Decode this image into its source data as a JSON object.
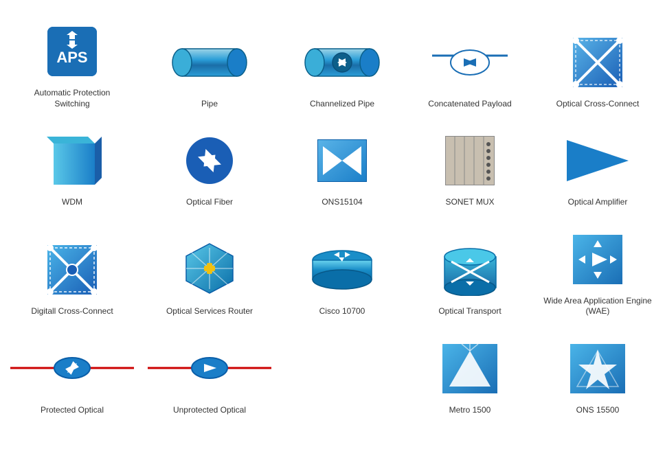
{
  "items": [
    {
      "id": "aps",
      "label": "Automatic Protection\nSwitching",
      "row": 1
    },
    {
      "id": "pipe",
      "label": "Pipe",
      "row": 1
    },
    {
      "id": "channelized-pipe",
      "label": "Channelized Pipe",
      "row": 1
    },
    {
      "id": "concatenated-payload",
      "label": "Concatenated Payload",
      "row": 1
    },
    {
      "id": "optical-cross-connect",
      "label": "Optical Cross-Connect",
      "row": 1
    },
    {
      "id": "wdm",
      "label": "WDM",
      "row": 2
    },
    {
      "id": "optical-fiber",
      "label": "Optical Fiber",
      "row": 2
    },
    {
      "id": "ons15104",
      "label": "ONS15104",
      "row": 2
    },
    {
      "id": "sonet-mux",
      "label": "SONET MUX",
      "row": 2
    },
    {
      "id": "optical-amplifier",
      "label": "Optical Amplifier",
      "row": 2
    },
    {
      "id": "digital-cross-connect",
      "label": "Digitall Cross-Connect",
      "row": 3
    },
    {
      "id": "optical-services-router",
      "label": "Optical Services Router",
      "row": 3
    },
    {
      "id": "cisco-10700",
      "label": "Cisco 10700",
      "row": 3
    },
    {
      "id": "optical-transport",
      "label": "Optical Transport",
      "row": 3
    },
    {
      "id": "wae",
      "label": "Wide Area Application\nEngine (WAE)",
      "row": 3
    },
    {
      "id": "protected-optical",
      "label": "Protected Optical",
      "row": 4
    },
    {
      "id": "unprotected-optical",
      "label": "Unprotected Optical",
      "row": 4
    },
    {
      "id": "metro-1500",
      "label": "Metro 1500",
      "row": 4
    },
    {
      "id": "ons-15500",
      "label": "ONS 15500",
      "row": 4
    }
  ],
  "colors": {
    "primary_blue": "#1a7ec8",
    "dark_blue": "#1a5eb5",
    "light_blue": "#5ac8e8",
    "accent_red": "#cc0000",
    "white": "#ffffff",
    "gray": "#b0a898"
  }
}
